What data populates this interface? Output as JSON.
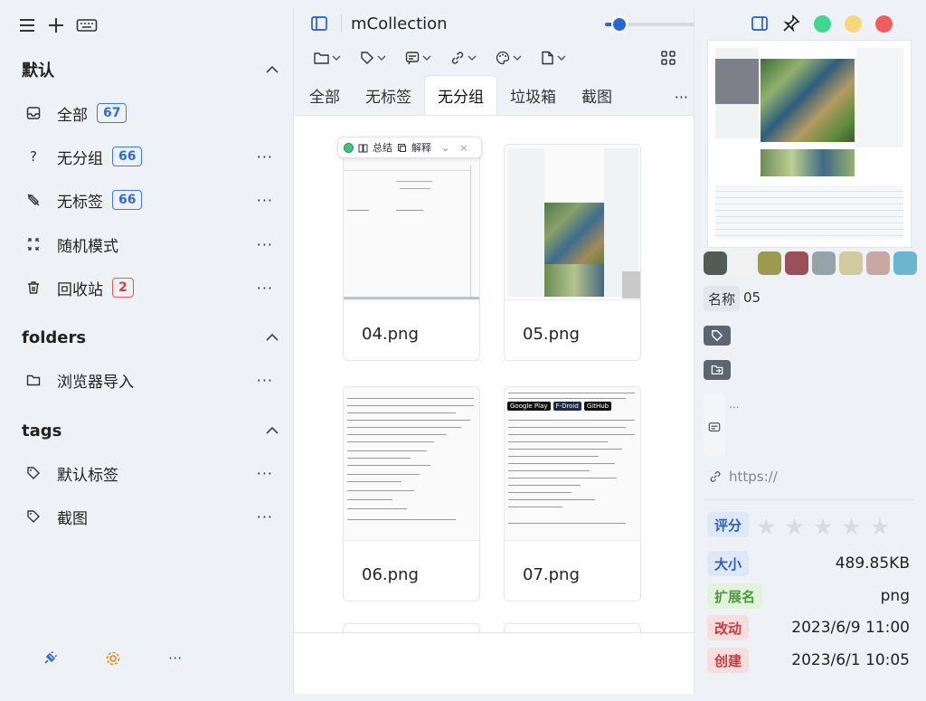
{
  "sidebar": {
    "sections": [
      {
        "title": "默认",
        "items": [
          {
            "label": "全部",
            "count": "67",
            "icon": "inbox-icon"
          },
          {
            "label": "无分组",
            "count": "66",
            "icon": "question-icon"
          },
          {
            "label": "无标签",
            "count": "66",
            "icon": "tag-off-icon"
          },
          {
            "label": "随机模式",
            "icon": "shuffle-icon"
          },
          {
            "label": "回收站",
            "count": "2",
            "icon": "trash-icon"
          }
        ]
      },
      {
        "title": "folders",
        "items": [
          {
            "label": "浏览器导入",
            "icon": "folder-icon"
          }
        ]
      },
      {
        "title": "tags",
        "items": [
          {
            "label": "默认标签",
            "icon": "tag-icon"
          },
          {
            "label": "截图",
            "icon": "tag-icon"
          }
        ]
      }
    ],
    "more": "···"
  },
  "main": {
    "title": "mCollection",
    "zoom_fraction": 0.12,
    "tabs": [
      {
        "label": "全部"
      },
      {
        "label": "无标签"
      },
      {
        "label": "无分组",
        "active": true
      },
      {
        "label": "垃圾箱"
      },
      {
        "label": "截图"
      }
    ],
    "tab_more": "···",
    "floatbar": {
      "summary": "总结",
      "explain": "解释",
      "chevron": "⌄",
      "close": "×"
    },
    "cards": [
      {
        "name": "04.png"
      },
      {
        "name": "05.png"
      },
      {
        "name": "06.png"
      },
      {
        "name": "07.png"
      }
    ],
    "thumb_badges": [
      "Google Play",
      "F-Droid",
      "GitHub"
    ]
  },
  "detail": {
    "colors": [
      "#545a54",
      "#f2f2f2",
      "#9d9a4f",
      "#9a5056",
      "#97a3ab",
      "#cfcb9a",
      "#c9a7a3",
      "#6bb6cf"
    ],
    "name_label": "名称",
    "name_value": "05",
    "note_placeholder": "...",
    "url_placeholder": "https://",
    "rating_label": "评分",
    "rating_value": 0,
    "rating_max": 5,
    "size_label": "大小",
    "size_value": "489.85KB",
    "ext_label": "扩展名",
    "ext_value": "png",
    "modified_label": "改动",
    "modified_value": "2023/6/9 11:00",
    "created_label": "创建",
    "created_value": "2023/6/1 10:05",
    "window_colors": [
      "#3fd68f",
      "#f5d978",
      "#f25c5c"
    ]
  }
}
